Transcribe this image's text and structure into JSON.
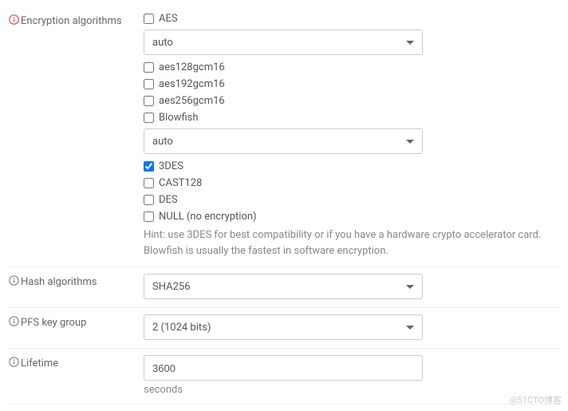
{
  "encryption": {
    "label": "Encryption algorithms",
    "aes": {
      "label": "AES",
      "checked": false
    },
    "aes_selector": "auto",
    "aes128gcm16": {
      "label": "aes128gcm16",
      "checked": false
    },
    "aes192gcm16": {
      "label": "aes192gcm16",
      "checked": false
    },
    "aes256gcm16": {
      "label": "aes256gcm16",
      "checked": false
    },
    "blowfish": {
      "label": "Blowfish",
      "checked": false
    },
    "blowfish_selector": "auto",
    "threedes": {
      "label": "3DES",
      "checked": true
    },
    "cast128": {
      "label": "CAST128",
      "checked": false
    },
    "des": {
      "label": "DES",
      "checked": false
    },
    "nullenc": {
      "label": "NULL (no encryption)",
      "checked": false
    },
    "hint": "Hint: use 3DES for best compatibility or if you have a hardware crypto accelerator card. Blowfish is usually the fastest in software encryption."
  },
  "hash": {
    "label": "Hash algorithms",
    "value": "SHA256"
  },
  "pfs": {
    "label": "PFS key group",
    "value": "2 (1024 bits)"
  },
  "lifetime": {
    "label": "Lifetime",
    "value": "3600",
    "unit": "seconds"
  },
  "watermark": "@51CTO博客"
}
